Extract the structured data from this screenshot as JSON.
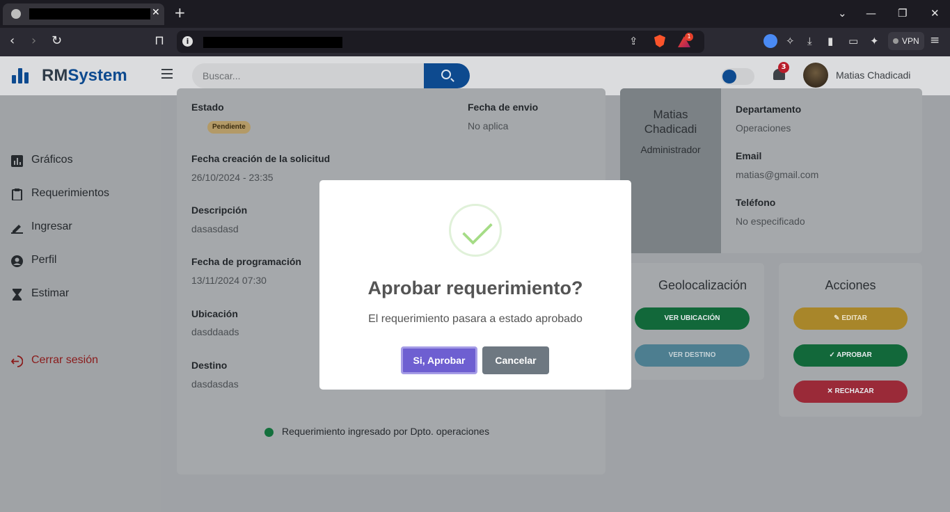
{
  "browser": {
    "new_tab": "+",
    "tab_close": "✕",
    "vpn_label": "VPN",
    "bat_badge": "1"
  },
  "app": {
    "brand_a": "RM",
    "brand_b": "System",
    "search_placeholder": "Buscar...",
    "notifications_count": "3",
    "user_name": "Matias Chadicadi"
  },
  "sidebar": {
    "items": [
      {
        "label": "Gráficos",
        "icon": "bar-chart-icon"
      },
      {
        "label": "Requerimientos",
        "icon": "clipboard-icon"
      },
      {
        "label": "Ingresar",
        "icon": "pencil-icon"
      },
      {
        "label": "Perfil",
        "icon": "user-circle-icon"
      },
      {
        "label": "Estimar",
        "icon": "hourglass-icon"
      }
    ],
    "logout": "Cerrar sesión"
  },
  "request": {
    "estado_label": "Estado",
    "estado_value": "Pendiente",
    "envio_label": "Fecha de envio",
    "envio_value": "No aplica",
    "creacion_label": "Fecha creación de la solicitud",
    "creacion_value": "26/10/2024 - 23:35",
    "descripcion_label": "Descripción",
    "descripcion_value": "dasasdasd",
    "programacion_label": "Fecha de programación",
    "programacion_value": "13/11/2024 07:30",
    "ubicacion_label": "Ubicación",
    "ubicacion_value": "dasddaads",
    "destino_label": "Destino",
    "destino_value": "dasdasdas",
    "footer_note": "Requerimiento ingresado por Dpto. operaciones"
  },
  "profile": {
    "name_line1": "Matias",
    "name_line2": "Chadicadi",
    "role": "Administrador",
    "departamento_label": "Departamento",
    "departamento_value": "Operaciones",
    "email_label": "Email",
    "email_value": "matias@gmail.com",
    "telefono_label": "Teléfono",
    "telefono_value": "No especificado"
  },
  "geo": {
    "title": "Geolocalización",
    "btn_ubicacion": "VER UBICACIÓN",
    "btn_destino": "VER DESTINO"
  },
  "actions": {
    "title": "Acciones",
    "btn_editar": "EDITAR",
    "btn_aprobar": "APROBAR",
    "btn_rechazar": "RECHAZAR"
  },
  "modal": {
    "title": "Aprobar requerimiento?",
    "text": "El requerimiento pasara a estado aprobado",
    "confirm": "Si, Aprobar",
    "cancel": "Cancelar"
  },
  "colors": {
    "brand": "#0d4a8f",
    "confirm": "#6e5fd1",
    "cancel": "#6e7881",
    "success_check": "#a5dc86"
  }
}
